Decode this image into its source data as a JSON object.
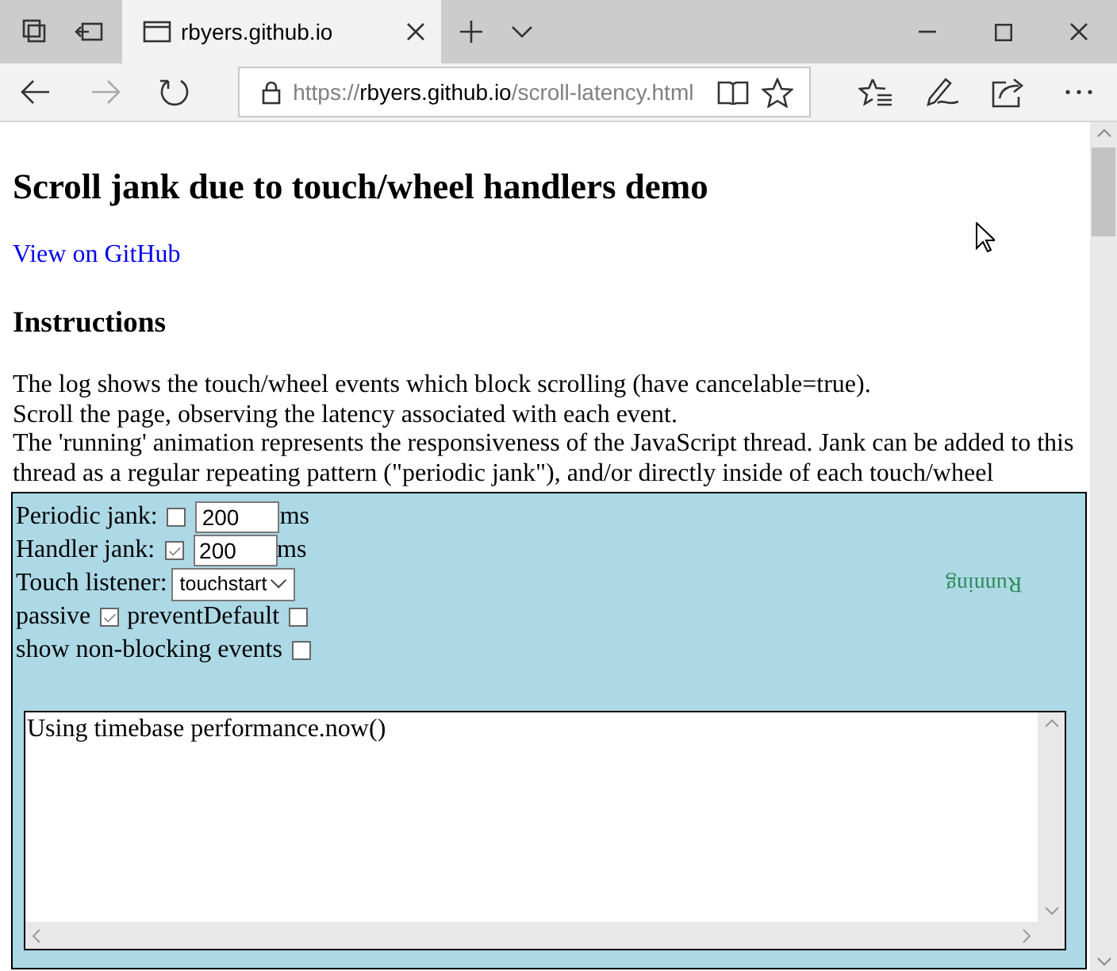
{
  "browser": {
    "tab": {
      "title": "rbyers.github.io"
    },
    "address": {
      "scheme": "https://",
      "host": "rbyers.github.io",
      "path": "/scroll-latency.html"
    }
  },
  "page": {
    "heading": "Scroll jank due to touch/wheel handlers demo",
    "link": "View on GitHub",
    "subheading": "Instructions",
    "instructions": [
      "The log shows the touch/wheel events which block scrolling (have cancelable=true).",
      "Scroll the page, observing the latency associated with each event.",
      "The 'running' animation represents the responsiveness of the JavaScript thread. Jank can be added to this thread as a regular repeating pattern (\"periodic jank\"), and/or directly inside of each touch/wheel"
    ]
  },
  "panel": {
    "rows": [
      {
        "items": [
          {
            "kind": "label",
            "text": "Periodic jank:"
          },
          {
            "kind": "checkbox",
            "checked": false
          },
          {
            "kind": "number",
            "value": "200"
          },
          {
            "kind": "unit",
            "text": "ms"
          }
        ]
      },
      {
        "items": [
          {
            "kind": "label",
            "text": "Handler jank:"
          },
          {
            "kind": "checkbox",
            "checked": true
          },
          {
            "kind": "number",
            "value": "200"
          },
          {
            "kind": "unit",
            "text": "ms"
          }
        ]
      },
      {
        "items": [
          {
            "kind": "label",
            "text": "Touch listener:"
          },
          {
            "kind": "select",
            "value": "touchstart"
          }
        ]
      },
      {
        "items": [
          {
            "kind": "label",
            "text": "passive"
          },
          {
            "kind": "checkbox",
            "checked": true
          },
          {
            "kind": "label",
            "text": "preventDefault"
          },
          {
            "kind": "checkbox",
            "checked": false
          }
        ]
      },
      {
        "items": [
          {
            "kind": "label",
            "text": "show non-blocking events"
          },
          {
            "kind": "checkbox",
            "checked": false
          }
        ]
      }
    ],
    "running_label": "Running",
    "log": {
      "lines": [
        "Using timebase performance.now()"
      ]
    }
  }
}
